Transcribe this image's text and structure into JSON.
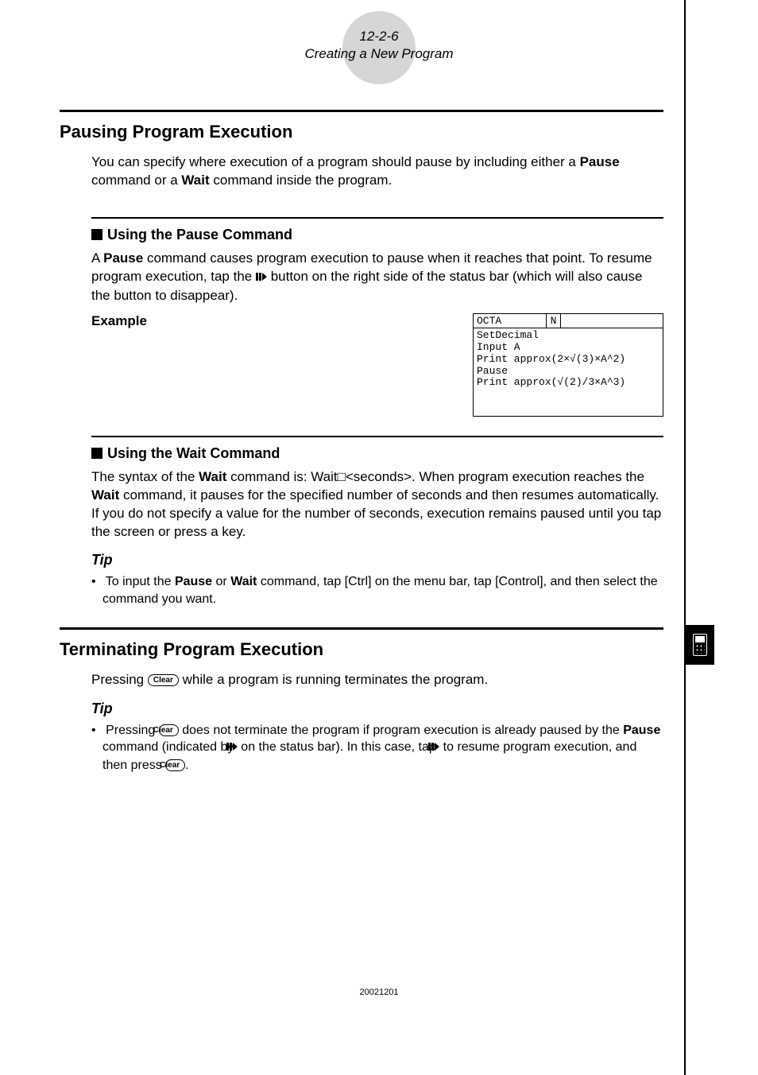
{
  "header": {
    "page_ref": "12-2-6",
    "title": "Creating a New Program"
  },
  "section1": {
    "heading": "Pausing Program Execution",
    "intro_pre": "You can specify where execution of a program should pause by including either a ",
    "intro_b1": "Pause",
    "intro_mid": " command or a ",
    "intro_b2": "Wait",
    "intro_post": " command inside the program."
  },
  "pause_cmd": {
    "heading": "Using the Pause Command",
    "p_a": "A ",
    "p_b1": "Pause",
    "p_c": " command causes program execution to pause when it reaches that point. To resume program execution, tap the ",
    "p_d": " button on the right side of the status bar (which will also cause the button to disappear).",
    "example_label": "Example"
  },
  "screenshot": {
    "title": "OCTA",
    "mode": "N",
    "code_lines": [
      "SetDecimal",
      "Input A",
      "Print approx(2×√(3)×A^2)",
      "Pause",
      "Print approx(√(2)/3×A^3)"
    ]
  },
  "wait_cmd": {
    "heading": "Using the Wait Command",
    "p_a": "The syntax of the ",
    "p_b1": "Wait",
    "p_c": " command is: Wait□<seconds>. When program execution reaches the ",
    "p_b2": "Wait",
    "p_d": " command, it pauses for the specified number of seconds and then resumes automatically. If you do not specify a value for the number of seconds, execution remains paused until you tap the screen or press a key.",
    "tip_label": "Tip",
    "tip_a": "To input the ",
    "tip_b1": "Pause",
    "tip_mid": " or ",
    "tip_b2": "Wait",
    "tip_c": " command, tap [Ctrl] on the menu bar, tap [Control], and then select the command you want."
  },
  "section2": {
    "heading": "Terminating Program Execution",
    "p_a": "Pressing ",
    "clear": "Clear",
    "p_b": " while a program is running terminates the program.",
    "tip_label": "Tip",
    "tip_a": "Pressing ",
    "tip_b": " does not terminate the program if program execution is already paused by the ",
    "tip_b1": "Pause",
    "tip_c": " command (indicated by ",
    "tip_d": " on the status bar). In this case, tap ",
    "tip_e": " to resume program execution, and then press ",
    "tip_f": "."
  },
  "footer": {
    "code": "20021201"
  }
}
